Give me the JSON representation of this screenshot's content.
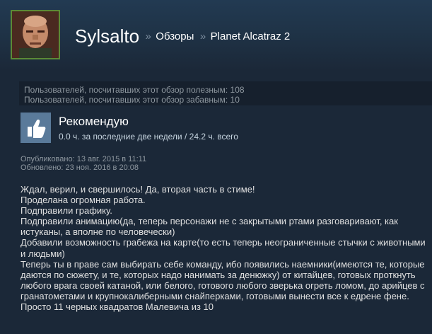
{
  "header": {
    "user_name": "Sylsalto",
    "separator": "»",
    "breadcrumb_reviews": "Обзоры",
    "breadcrumb_game": "Planet Alcatraz 2"
  },
  "ratings": {
    "helpful": "Пользователей, посчитавших этот обзор полезным: 108",
    "funny": "Пользователей, посчитавших этот обзор забавным: 10"
  },
  "recommendation": {
    "icon": "thumbs-up-icon",
    "title": "Рекомендую",
    "hours": "0.0 ч. за последние две недели / 24.2 ч. всего"
  },
  "dates": {
    "published": "Опубликовано: 13 авг. 2015 в 11:11",
    "updated": "Обновлено: 23 ноя. 2016 в 20:08"
  },
  "review_lines": [
    "Ждал, верил, и свершилось! Да, вторая часть в стиме!",
    "Проделана огромная работа.",
    "Подправили графику.",
    "Подправили анимацию(да, теперь персонажи не с закрытыми ртами разговаривают, как истуканы, а вполне по человечески)",
    "Добавили возможность грабежа на карте(то есть теперь неограниченные стычки с животными и людьми)",
    "Теперь ты в праве сам выбирать себе команду, ибо появились наемники(имеются те, которые даются по сюжету, и те, которых надо нанимать за денюжку) от китайцев, готовых проткнуть любого врага своей катаной, или белого, готового любого зверька огреть ломом, до арийцев с гранатометами и крупнокалиберными снайперками, готовыми вынести все к едрене фене.",
    "Просто 11 черных квадратов Малевича из 10"
  ],
  "colors": {
    "background": "#1b2838",
    "ratings_bg": "#16202d",
    "thumb_bg": "#5a7a9a",
    "avatar_border": "#5b8a36"
  }
}
